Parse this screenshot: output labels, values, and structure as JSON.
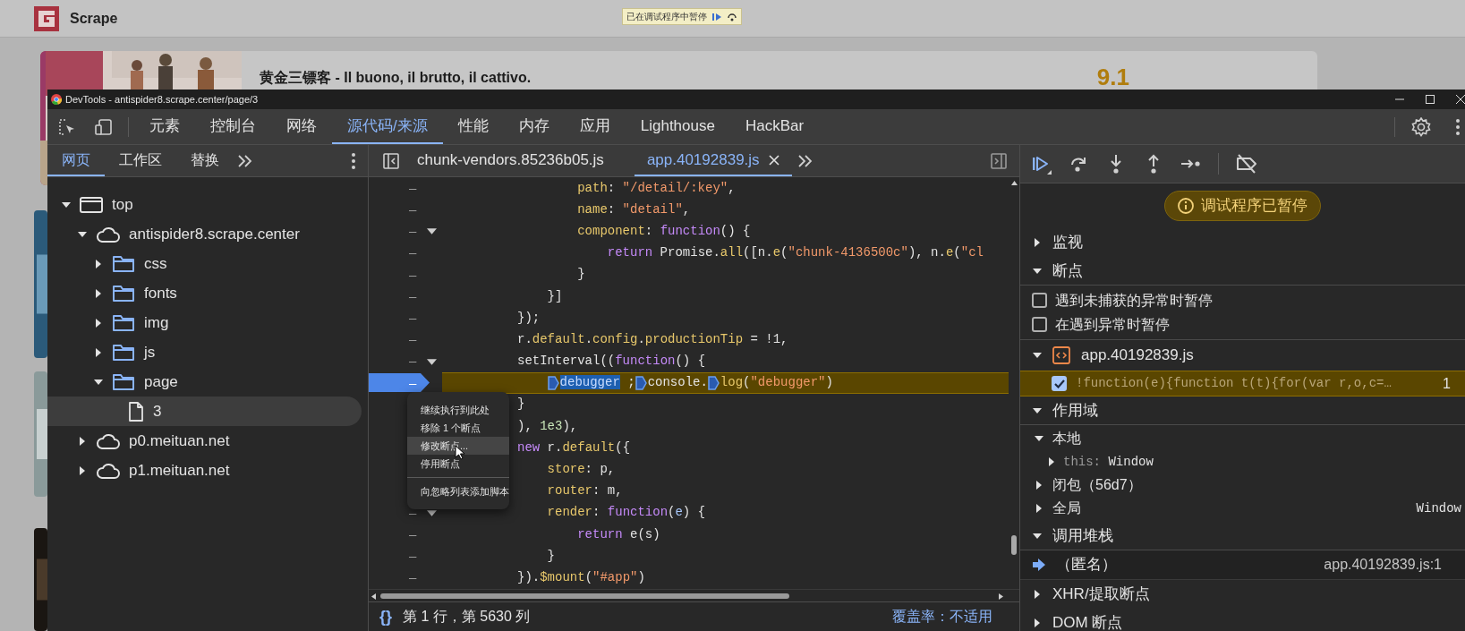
{
  "page": {
    "site_name": "Scrape",
    "paused_banner": "已在调试程序中暂停",
    "movie": {
      "title": "黄金三镖客 - Il buono, il brutto, il cattivo.",
      "score": "9.1"
    }
  },
  "devtools": {
    "title": "DevTools - antispider8.scrape.center/page/3",
    "tabs": [
      {
        "label": "元素",
        "selected": false
      },
      {
        "label": "控制台",
        "selected": false
      },
      {
        "label": "网络",
        "selected": false
      },
      {
        "label": "源代码/来源",
        "selected": true
      },
      {
        "label": "性能",
        "selected": false
      },
      {
        "label": "内存",
        "selected": false
      },
      {
        "label": "应用",
        "selected": false
      },
      {
        "label": "Lighthouse",
        "selected": false
      },
      {
        "label": "HackBar",
        "selected": false
      }
    ],
    "navigator": {
      "tabs": [
        {
          "label": "网页",
          "selected": true
        },
        {
          "label": "工作区",
          "selected": false
        },
        {
          "label": "替换",
          "selected": false
        }
      ],
      "tree": [
        {
          "label": "top",
          "kind": "frame",
          "expanded": true,
          "selected": false,
          "children": [
            {
              "label": "antispider8.scrape.center",
              "kind": "domain",
              "expanded": true,
              "selected": false,
              "children": [
                {
                  "label": "css",
                  "kind": "folder",
                  "expanded": false,
                  "selected": false
                },
                {
                  "label": "fonts",
                  "kind": "folder",
                  "expanded": false,
                  "selected": false
                },
                {
                  "label": "img",
                  "kind": "folder",
                  "expanded": false,
                  "selected": false
                },
                {
                  "label": "js",
                  "kind": "folder",
                  "expanded": false,
                  "selected": false
                },
                {
                  "label": "page",
                  "kind": "folder",
                  "expanded": true,
                  "selected": false,
                  "children": [
                    {
                      "label": "3",
                      "kind": "file",
                      "selected": true
                    }
                  ]
                }
              ]
            },
            {
              "label": "p0.meituan.net",
              "kind": "domain",
              "expanded": false,
              "selected": false
            },
            {
              "label": "p1.meituan.net",
              "kind": "domain",
              "expanded": false,
              "selected": false
            }
          ]
        }
      ]
    },
    "editor": {
      "tabs": [
        {
          "label": "chunk-vendors.85236b05.js",
          "selected": false
        },
        {
          "label": "app.40192839.js",
          "selected": true,
          "closable": true
        }
      ],
      "lines": [
        {
          "children": [
            {
              "children": [
                {
                  "gutter": "–",
                  "tokens": [
                    {
                      "kind": "y",
                      "text": "path"
                    },
                    {
                      "kind": "p",
                      "text": ": "
                    },
                    {
                      "kind": "s",
                      "text": "\"/detail/:key\""
                    },
                    {
                      "kind": "p",
                      "text": ","
                    }
                  ]
                },
                {
                  "gutter": "–",
                  "tokens": [
                    {
                      "kind": "y",
                      "text": "name"
                    },
                    {
                      "kind": "p",
                      "text": ": "
                    },
                    {
                      "kind": "s",
                      "text": "\"detail\""
                    },
                    {
                      "kind": "p",
                      "text": ","
                    }
                  ]
                },
                {
                  "gutter": "–",
                  "fold": true,
                  "tokens": [
                    {
                      "kind": "y",
                      "text": "component"
                    },
                    {
                      "kind": "p",
                      "text": ": "
                    },
                    {
                      "kind": "k",
                      "text": "function"
                    },
                    {
                      "kind": "p",
                      "text": "() {"
                    }
                  ],
                  "children": [
                    {
                      "gutter": "–",
                      "tokens": [
                        {
                          "kind": "k",
                          "text": "return"
                        },
                        {
                          "kind": "p",
                          "text": " Promise."
                        },
                        {
                          "kind": "y",
                          "text": "all"
                        },
                        {
                          "kind": "p",
                          "text": "([n."
                        },
                        {
                          "kind": "y",
                          "text": "e"
                        },
                        {
                          "kind": "p",
                          "text": "("
                        },
                        {
                          "kind": "s",
                          "text": "\"chunk-4136500c\""
                        },
                        {
                          "kind": "p",
                          "text": "), n."
                        },
                        {
                          "kind": "y",
                          "text": "e"
                        },
                        {
                          "kind": "p",
                          "text": "("
                        },
                        {
                          "kind": "s",
                          "text": "\"cl"
                        }
                      ]
                    }
                  ]
                },
                {
                  "gutter": "–",
                  "tokens": [
                    {
                      "kind": "p",
                      "text": "}"
                    }
                  ]
                }
              ]
            },
            {
              "gutter": "–",
              "tokens": [
                {
                  "kind": "p",
                  "text": "}]"
                }
              ]
            }
          ]
        },
        {
          "gutter": "–",
          "tokens": [
            {
              "kind": "p",
              "text": "});"
            }
          ]
        },
        {
          "gutter": "–",
          "tokens": [
            {
              "kind": "p",
              "text": "r."
            },
            {
              "kind": "y",
              "text": "default"
            },
            {
              "kind": "p",
              "text": "."
            },
            {
              "kind": "y",
              "text": "config"
            },
            {
              "kind": "p",
              "text": "."
            },
            {
              "kind": "y",
              "text": "productionTip"
            },
            {
              "kind": "p",
              "text": " = !1,"
            }
          ]
        },
        {
          "gutter": "–",
          "fold": true,
          "tokens": [
            {
              "kind": "p",
              "text": "setInterval(("
            },
            {
              "kind": "k",
              "text": "function"
            },
            {
              "kind": "p",
              "text": "() {"
            }
          ],
          "children": [
            {
              "gutter": "–",
              "breakpoint": true,
              "paused": true,
              "tokens": [
                {
                  "kind": "marker"
                },
                {
                  "kind": "sel",
                  "text": "debugger"
                },
                {
                  "kind": "p",
                  "text": " ;"
                },
                {
                  "kind": "marker"
                },
                {
                  "kind": "p",
                  "text": "console."
                },
                {
                  "kind": "marker"
                },
                {
                  "kind": "y",
                  "text": "log"
                },
                {
                  "kind": "p",
                  "text": "("
                },
                {
                  "kind": "s",
                  "text": "\"debugger\""
                },
                {
                  "kind": "p",
                  "text": ")"
                }
              ]
            }
          ]
        },
        {
          "tokens": [
            {
              "kind": "p",
              "text": "}"
            }
          ]
        },
        {
          "tokens": [
            {
              "kind": "p",
              "text": "), "
            },
            {
              "kind": "n",
              "text": "1e3"
            },
            {
              "kind": "p",
              "text": "),"
            }
          ]
        },
        {
          "tokens": [
            {
              "kind": "k",
              "text": "new"
            },
            {
              "kind": "p",
              "text": " r."
            },
            {
              "kind": "y",
              "text": "default"
            },
            {
              "kind": "p",
              "text": "({"
            }
          ],
          "children": [
            {
              "tokens": [
                {
                  "kind": "y",
                  "text": "store"
                },
                {
                  "kind": "p",
                  "text": ": p,"
                }
              ]
            },
            {
              "tokens": [
                {
                  "kind": "y",
                  "text": "router"
                },
                {
                  "kind": "p",
                  "text": ": m,"
                }
              ]
            },
            {
              "gutter": "–",
              "fold": true,
              "tokens": [
                {
                  "kind": "y",
                  "text": "render"
                },
                {
                  "kind": "p",
                  "text": ": "
                },
                {
                  "kind": "k",
                  "text": "function"
                },
                {
                  "kind": "p",
                  "text": "("
                },
                {
                  "kind": "v",
                  "text": "e"
                },
                {
                  "kind": "p",
                  "text": ") {"
                }
              ],
              "children": [
                {
                  "gutter": "–",
                  "tokens": [
                    {
                      "kind": "k",
                      "text": "return"
                    },
                    {
                      "kind": "p",
                      "text": " e(s)"
                    }
                  ]
                }
              ]
            },
            {
              "gutter": "–",
              "tokens": [
                {
                  "kind": "p",
                  "text": "}"
                }
              ]
            }
          ]
        },
        {
          "gutter": "–",
          "tokens": [
            {
              "kind": "p",
              "text": "})."
            },
            {
              "kind": "y",
              "text": "$mount"
            },
            {
              "kind": "p",
              "text": "("
            },
            {
              "kind": "s",
              "text": "\"#app\""
            },
            {
              "kind": "p",
              "text": ")"
            }
          ]
        }
      ],
      "context_menu": {
        "groups": [
          [
            {
              "label": "继续执行到此处",
              "selected": false
            },
            {
              "label": "移除 1 个断点",
              "selected": false
            },
            {
              "label": "修改断点...",
              "selected": true
            },
            {
              "label": "停用断点",
              "selected": false
            }
          ],
          [
            {
              "label": "向忽略列表添加脚本",
              "selected": false
            }
          ]
        ]
      },
      "status": {
        "pretty_print": "{}",
        "position": "第 1 行，第 5630 列",
        "coverage": "覆盖率：不适用"
      }
    },
    "debugger": {
      "paused_badge": "调试程序已暂停",
      "sections": [
        {
          "kind": "plain",
          "title": "监视",
          "expanded": false
        },
        {
          "kind": "breakpoints",
          "title": "断点",
          "expanded": true,
          "options": [
            {
              "label": "遇到未捕获的异常时暂停",
              "checked": false
            },
            {
              "label": "在遇到异常时暂停",
              "checked": false
            }
          ],
          "files": [
            {
              "name": "app.40192839.js",
              "expanded": true,
              "breakpoints": [
                {
                  "code": "!function(e){function t(t){for(var r,o,c=…",
                  "line": "1",
                  "checked": true,
                  "selected": true
                }
              ]
            }
          ]
        },
        {
          "kind": "scope",
          "title": "作用域",
          "expanded": true,
          "scopes": [
            {
              "label": "本地",
              "expanded": true,
              "children": [
                {
                  "name": "this:",
                  "value": "Window",
                  "expanded": false
                }
              ]
            },
            {
              "label": "闭包（56d7）",
              "expanded": false
            },
            {
              "label": "全局",
              "value": "Window",
              "expanded": false
            }
          ]
        },
        {
          "kind": "callstack",
          "title": "调用堆栈",
          "expanded": true,
          "frames": [
            {
              "name": "（匿名）",
              "location": "app.40192839.js:1",
              "selected": true
            }
          ]
        },
        {
          "kind": "plain",
          "title": "XHR/提取断点",
          "expanded": false
        },
        {
          "kind": "plain",
          "title": "DOM 断点",
          "expanded": false
        }
      ]
    }
  }
}
